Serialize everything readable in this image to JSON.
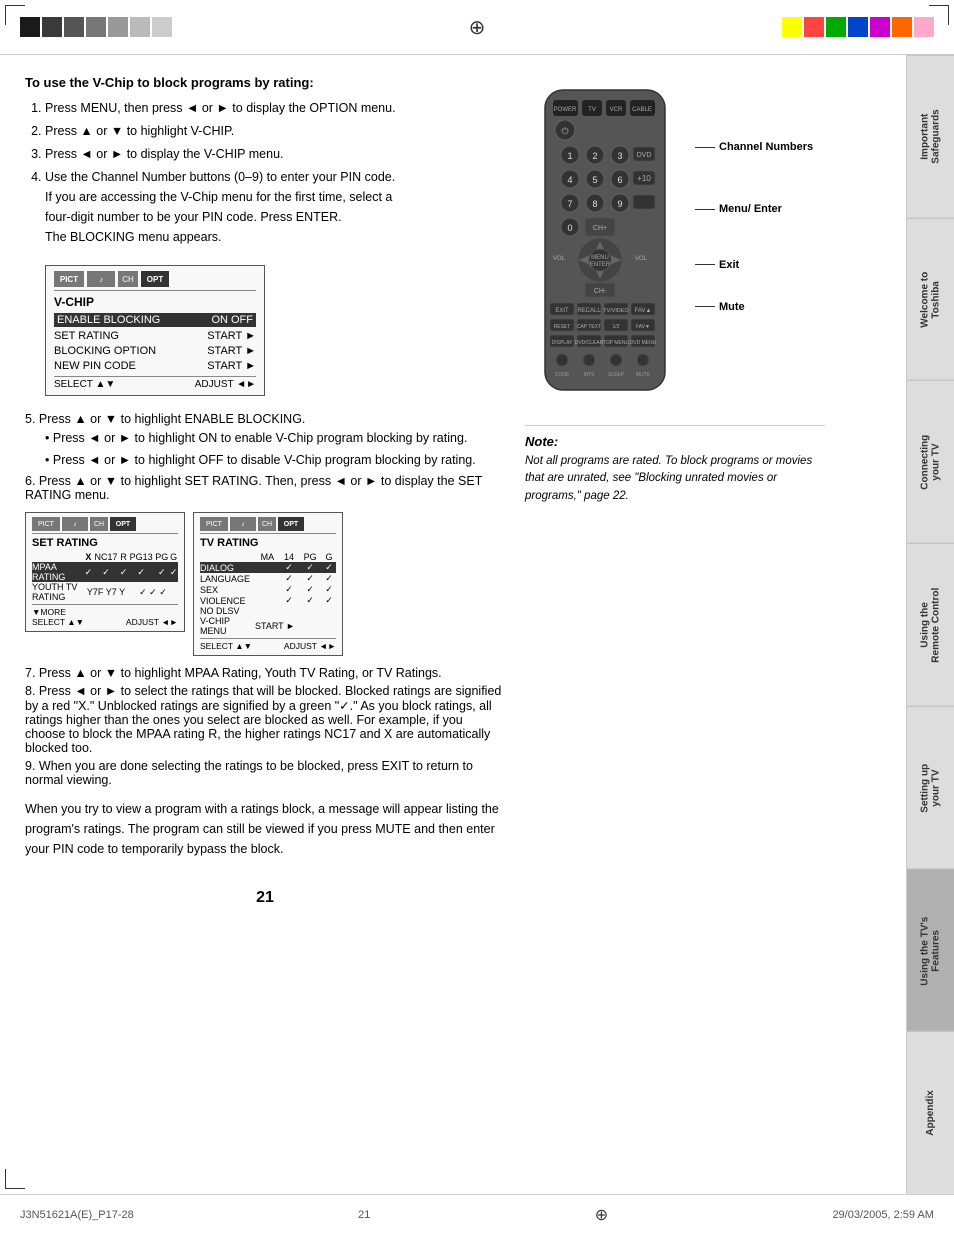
{
  "page": {
    "number": "21",
    "bottom_left": "J3N51621A(E)_P17-28",
    "bottom_center": "21",
    "bottom_right": "29/03/2005, 2:59 AM"
  },
  "sidebar": {
    "tabs": [
      {
        "id": "important-safeguards",
        "label": "Important Safeguards"
      },
      {
        "id": "welcome-toshiba",
        "label": "Welcome to Toshiba"
      },
      {
        "id": "connecting-tv",
        "label": "Connecting your TV"
      },
      {
        "id": "remote-control",
        "label": "Using the Remote Control"
      },
      {
        "id": "setting-up",
        "label": "Setting up your TV"
      },
      {
        "id": "tvs-features",
        "label": "Using the TV's Features",
        "active": true
      },
      {
        "id": "appendix",
        "label": "Appendix"
      }
    ]
  },
  "top_colors_left": [
    "#1a1a1a",
    "#3a3a3a",
    "#555",
    "#777",
    "#999",
    "#bbb",
    "#ccc"
  ],
  "top_colors_right": [
    "#ffff00",
    "#ff0000",
    "#00aa00",
    "#0000ff",
    "#ff00ff",
    "#ff6600",
    "#ff99cc"
  ],
  "section": {
    "title": "To use the V-Chip to block programs by rating:",
    "steps": [
      {
        "num": "1",
        "text": "Press MENU, then press ◄ or ► to display the OPTION menu."
      },
      {
        "num": "2",
        "text": "Press ▲ or ▼ to highlight V-CHIP."
      },
      {
        "num": "3",
        "text": "Press ◄ or ► to display the V-CHIP menu."
      },
      {
        "num": "4",
        "text": "Use the Channel Number buttons (0–9) to enter your PIN code. If you are accessing the V-Chip menu for the first time, select a four-digit number to be your PIN code. Press ENTER. The BLOCKING menu appears."
      }
    ],
    "steps5to9": [
      {
        "num": "5",
        "text": "Press ▲ or ▼ to highlight ENABLE BLOCKING.",
        "bullets": [
          "Press ◄ or ► to highlight ON to enable V-Chip program blocking by rating.",
          "Press ◄ or ► to highlight OFF to disable V-Chip program blocking by rating."
        ]
      },
      {
        "num": "6",
        "text": "Press ▲ or ▼ to highlight SET RATING. Then, press ◄ or ► to display the SET RATING menu."
      },
      {
        "num": "7",
        "text": "Press ▲ or ▼ to highlight MPAA Rating, Youth TV Rating, or TV Ratings."
      },
      {
        "num": "8",
        "text": "Press ◄ or ► to select the ratings that will be blocked. Blocked ratings are signified by a red \"X.\" Unblocked ratings are signified by a green \"✓.\" As you block ratings, all ratings higher than the ones you select are blocked as well. For example, if you choose to block the MPAA rating R, the higher ratings NC17 and X are automatically blocked too."
      },
      {
        "num": "9",
        "text": "When you are done selecting the ratings to be blocked, press EXIT to return to normal viewing."
      }
    ],
    "closing_text": "When you try to view a program with a ratings block, a message will appear listing the program's ratings. The program can still be viewed if you press MUTE and then enter your PIN code to temporarily bypass the block."
  },
  "vchip_menu": {
    "title": "V-CHIP",
    "rows": [
      {
        "label": "ENABLE BLOCKING",
        "values": [
          "ON",
          "OFF"
        ],
        "highlight": true
      },
      {
        "label": "SET RATING",
        "values": [
          "START",
          "►"
        ]
      },
      {
        "label": "BLOCKING OPTION",
        "values": [
          "START",
          "►"
        ]
      },
      {
        "label": "NEW PIN CODE",
        "values": [
          "START",
          "►"
        ]
      }
    ],
    "footer_select": "SELECT  ▲▼",
    "footer_adjust": "ADJUST  ◄►"
  },
  "set_rating_menu": {
    "title": "SET RATING",
    "columns": [
      "",
      "NC17",
      "R",
      "PG13",
      "PG",
      "G"
    ],
    "rows": [
      {
        "label": "MPAA RATING",
        "values": [
          "X",
          "✓",
          "✓",
          "✓",
          "✓",
          "✓"
        ]
      },
      {
        "label": "YOUTH TV RATING",
        "values": [
          "",
          "",
          "",
          "",
          "",
          ""
        ],
        "subtext": "Y7F Y7 Y"
      }
    ],
    "footer": "▼MORE",
    "footer_select": "SELECT  ▲▼",
    "footer_adjust": "ADJUST  ◄►"
  },
  "tv_rating_menu": {
    "title": "TV RATING",
    "columns": [
      "MA",
      "14",
      "PG",
      "G"
    ],
    "rows": [
      {
        "label": "DIALOG",
        "values": [
          "",
          "✓",
          "✓",
          "✓"
        ]
      },
      {
        "label": "LANGUAGE",
        "values": [
          "",
          "✓",
          "✓",
          "✓"
        ]
      },
      {
        "label": "SEX",
        "values": [
          "",
          "✓",
          "✓",
          "✓"
        ]
      },
      {
        "label": "VIOLENCE",
        "values": [
          "",
          "✓",
          "✓",
          "✓"
        ]
      },
      {
        "label": "NO DLSV",
        "values": [
          "",
          "",
          "",
          ""
        ]
      },
      {
        "label": "V-CHIP MENU",
        "values": [
          "START",
          "►"
        ]
      }
    ],
    "footer_select": "SELECT  ▲▼",
    "footer_adjust": "ADJUST  ◄►"
  },
  "remote": {
    "labels": {
      "channel_numbers": "Channel Numbers",
      "menu_enter": "Menu/ Enter",
      "exit": "Exit",
      "mute": "Mute"
    }
  },
  "note": {
    "title": "Note:",
    "text": "Not all programs are rated. To block programs or movies that are unrated, see \"Blocking unrated movies or programs,\" page 22."
  }
}
